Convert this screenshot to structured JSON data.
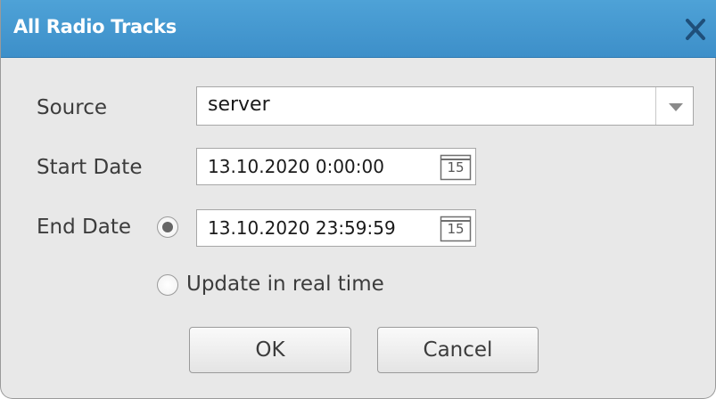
{
  "window": {
    "title": "All Radio Tracks",
    "close_icon": "close-icon"
  },
  "form": {
    "source_label": "Source",
    "source_value": "server",
    "start_label": "Start Date",
    "start_value": "13.10.2020 0:00:00",
    "end_label": "End Date",
    "end_value": "13.10.2020 23:59:59",
    "calendar_day": "15",
    "realtime_label": "Update in real time",
    "end_date_selected": true,
    "realtime_selected": false
  },
  "buttons": {
    "ok": "OK",
    "cancel": "Cancel"
  },
  "colors": {
    "titlebar": "#4ea2d7",
    "background": "#e8e8e8"
  }
}
